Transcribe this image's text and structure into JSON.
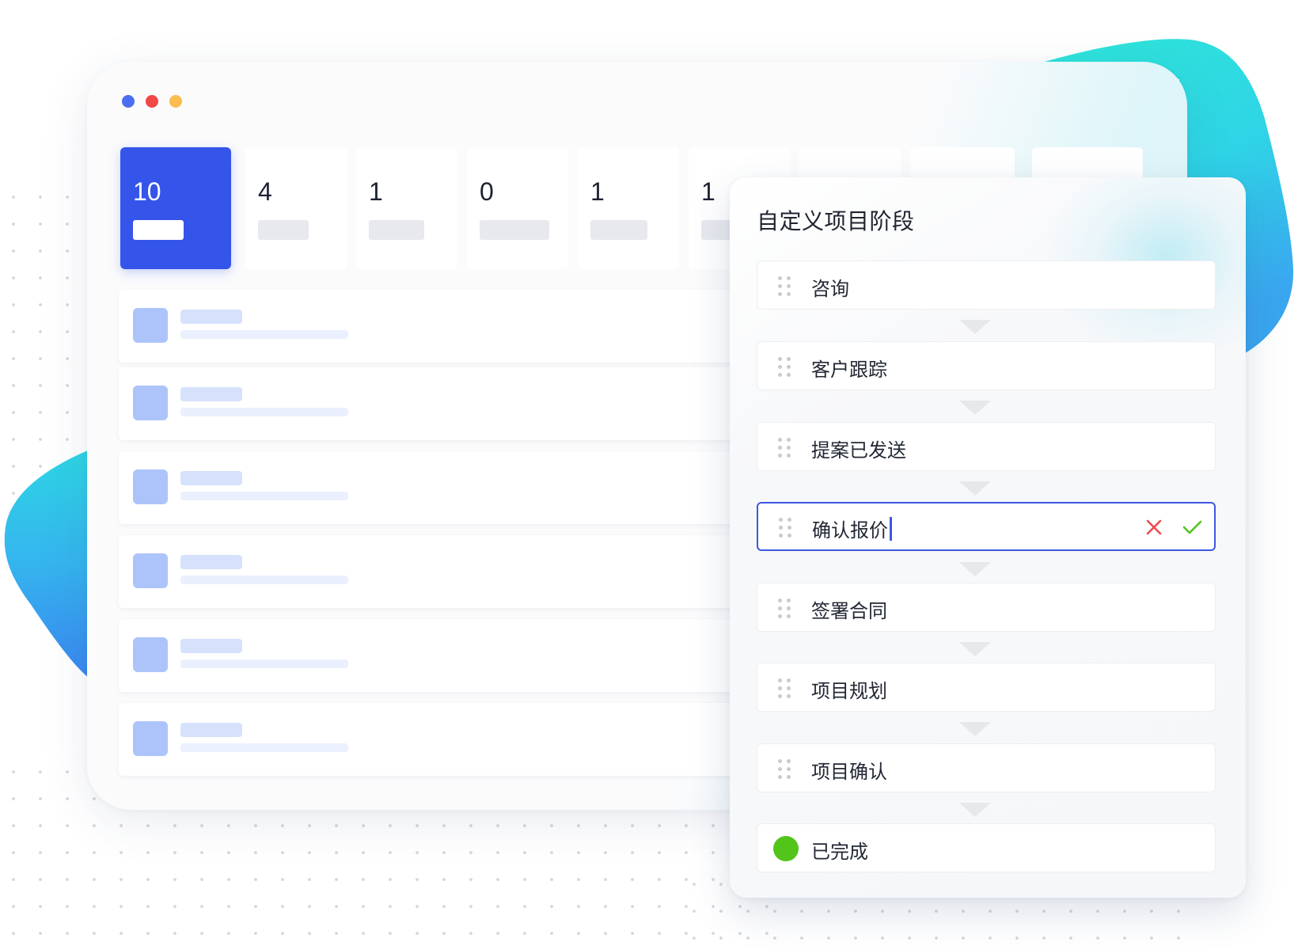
{
  "colors": {
    "accent": "#3555ea",
    "traffic_blue": "#4a6ff0",
    "traffic_red": "#f04747",
    "traffic_yellow": "#fbbd4d",
    "teal_blob": "#2de3dc",
    "blue_blob": "#3a8cf0",
    "cancel": "#f04a4a",
    "confirm": "#52c41a",
    "done": "#52c41a"
  },
  "stats": [
    {
      "value": "10",
      "active": true
    },
    {
      "value": "4",
      "active": false
    },
    {
      "value": "1",
      "active": false
    },
    {
      "value": "0",
      "active": false
    },
    {
      "value": "1",
      "active": false
    },
    {
      "value": "1",
      "active": false
    },
    {
      "value": "",
      "active": false
    },
    {
      "value": "",
      "active": false
    },
    {
      "value": "",
      "active": false
    }
  ],
  "list_row_count": 6,
  "panel": {
    "title": "自定义项目阶段",
    "stages": [
      {
        "label": "咨询",
        "icon": "drag-handle-icon"
      },
      {
        "label": "客户跟踪",
        "icon": "drag-handle-icon"
      },
      {
        "label": "提案已发送",
        "icon": "drag-handle-icon"
      },
      {
        "label": "确认报价",
        "icon": "drag-handle-icon",
        "editing": true
      },
      {
        "label": "签署合同",
        "icon": "drag-handle-icon"
      },
      {
        "label": "项目规划",
        "icon": "drag-handle-icon"
      },
      {
        "label": "项目确认",
        "icon": "drag-handle-icon"
      },
      {
        "label": "已完成",
        "icon": "green-status-dot-icon"
      }
    ],
    "edit_actions": [
      "cancel-icon",
      "confirm-check-icon"
    ]
  }
}
